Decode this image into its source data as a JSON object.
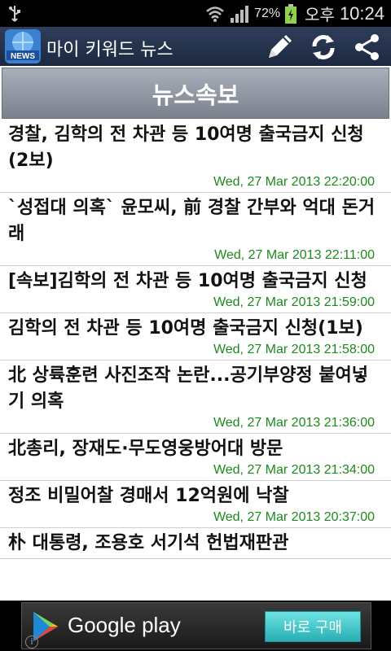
{
  "status_bar": {
    "battery_percent": "72%",
    "ampm": "오후",
    "time": "10:24",
    "icons": [
      "usb-icon",
      "wifi-icon",
      "signal-icon",
      "battery-icon"
    ]
  },
  "action_bar": {
    "title": "마이 키워드 뉴스",
    "logo_text": "NEWS",
    "icons": [
      "edit-icon",
      "refresh-icon",
      "share-icon"
    ]
  },
  "section": {
    "title": "뉴스속보"
  },
  "news": [
    {
      "title": "경찰, 김학의 전 차관 등 10여명 출국금지 신청(2보)",
      "date": "Wed, 27 Mar 2013 22:20:00"
    },
    {
      "title": "`성접대 의혹` 윤모씨, 前 경찰 간부와 억대 돈거래",
      "date": "Wed, 27 Mar 2013 22:11:00"
    },
    {
      "title": "[속보]김학의 전 차관 등 10여명 출국금지 신청",
      "date": "Wed, 27 Mar 2013 21:59:00"
    },
    {
      "title": "김학의 전 차관 등 10여명 출국금지 신청(1보)",
      "date": "Wed, 27 Mar 2013 21:58:00"
    },
    {
      "title": "北 상륙훈련 사진조작 논란...공기부양정 붙여넣기 의혹",
      "date": "Wed, 27 Mar 2013 21:36:00"
    },
    {
      "title": "北총리, 장재도·무도영웅방어대 방문",
      "date": "Wed, 27 Mar 2013 21:34:00"
    },
    {
      "title": "정조 비밀어찰 경매서 12억원에 낙찰",
      "date": "Wed, 27 Mar 2013 20:37:00"
    },
    {
      "title": "朴 대통령, 조용호 서기석 헌법재판관",
      "date": ""
    }
  ],
  "ad": {
    "store_name": "Google play",
    "button_label": "바로 구매",
    "info": "i",
    "colors": {
      "button": "#27aeb3"
    }
  },
  "colors": {
    "date": "#1b8a1b",
    "action_bar": "#1c2840"
  }
}
